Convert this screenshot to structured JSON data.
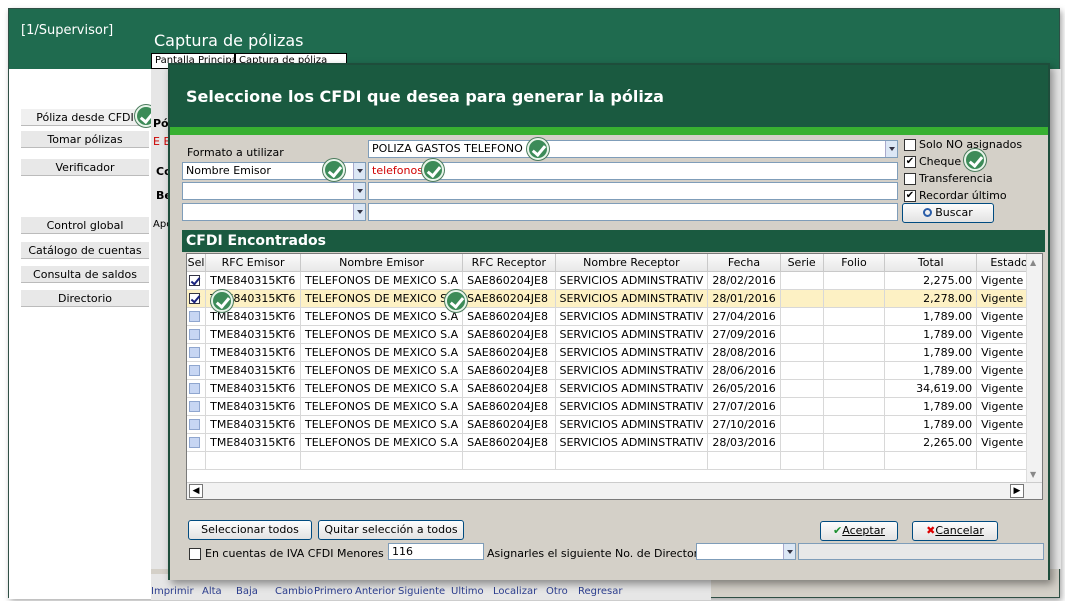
{
  "app": {
    "user": "[1/Supervisor]",
    "title": "Captura de pólizas",
    "tabs": [
      "Pantalla Principal",
      "Captura de póliza"
    ],
    "background_labels": {
      "pol": "Pól",
      "e": "E E",
      "co": "Co",
      "be": "Be",
      "ape": "Ape"
    }
  },
  "sidebar": {
    "items": [
      "Póliza desde CFDI",
      "Tomar pólizas",
      "Verificador",
      "Control global",
      "Catálogo de cuentas",
      "Consulta de saldos",
      "Directorio"
    ]
  },
  "toolbar": {
    "items": [
      "Imprimir",
      "Alta",
      "Baja",
      "Cambio",
      "Primero",
      "Anterior",
      "Siguiente",
      "Ultimo",
      "Localizar",
      "Otro",
      "Regresar"
    ]
  },
  "dialog": {
    "title": "Seleccione los CFDI que desea para generar la póliza",
    "format_label": "Formato a utilizar",
    "format_value": "POLIZA GASTOS TELEFONO",
    "filter1_field": "Nombre Emisor",
    "filter1_value": "telefonos",
    "filter2_field": "",
    "filter2_value": "",
    "filter3_field": "",
    "filter3_value": "",
    "options": [
      {
        "label": "Solo NO asignados",
        "checked": false
      },
      {
        "label": "Cheque",
        "checked": true
      },
      {
        "label": "Transferencia",
        "checked": false
      },
      {
        "label": "Recordar último",
        "checked": true
      }
    ],
    "search_button": "Buscar",
    "found_title": "CFDI Encontrados",
    "columns": [
      "Sel",
      "RFC Emisor",
      "Nombre Emisor",
      "RFC Receptor",
      "Nombre Receptor",
      "Fecha",
      "Serie",
      "Folio",
      "Total",
      "Estado"
    ],
    "rows": [
      {
        "sel": true,
        "rfc_emisor": "TME840315KT6",
        "nombre_emisor": "TELEFONOS DE MEXICO S.A",
        "rfc_receptor": "SAE860204JE8",
        "nombre_receptor": "SERVICIOS ADMINSTRATIV",
        "fecha": "28/02/2016",
        "serie": "",
        "folio": "",
        "total": "2,275.00",
        "estado": "Vigente"
      },
      {
        "sel": true,
        "rfc_emisor": "TME840315KT6",
        "nombre_emisor": "TELEFONOS DE MEXICO S.A",
        "rfc_receptor": "SAE860204JE8",
        "nombre_receptor": "SERVICIOS ADMINSTRATIV",
        "fecha": "28/01/2016",
        "serie": "",
        "folio": "",
        "total": "2,278.00",
        "estado": "Vigente",
        "highlight": true
      },
      {
        "sel": false,
        "rfc_emisor": "TME840315KT6",
        "nombre_emisor": "TELEFONOS DE MEXICO S.A",
        "rfc_receptor": "SAE860204JE8",
        "nombre_receptor": "SERVICIOS ADMINSTRATIV",
        "fecha": "27/04/2016",
        "serie": "",
        "folio": "",
        "total": "1,789.00",
        "estado": "Vigente"
      },
      {
        "sel": false,
        "rfc_emisor": "TME840315KT6",
        "nombre_emisor": "TELEFONOS DE MEXICO S.A",
        "rfc_receptor": "SAE860204JE8",
        "nombre_receptor": "SERVICIOS ADMINSTRATIV",
        "fecha": "27/09/2016",
        "serie": "",
        "folio": "",
        "total": "1,789.00",
        "estado": "Vigente"
      },
      {
        "sel": false,
        "rfc_emisor": "TME840315KT6",
        "nombre_emisor": "TELEFONOS DE MEXICO S.A",
        "rfc_receptor": "SAE860204JE8",
        "nombre_receptor": "SERVICIOS ADMINSTRATIV",
        "fecha": "28/08/2016",
        "serie": "",
        "folio": "",
        "total": "1,789.00",
        "estado": "Vigente"
      },
      {
        "sel": false,
        "rfc_emisor": "TME840315KT6",
        "nombre_emisor": "TELEFONOS DE MEXICO S.A",
        "rfc_receptor": "SAE860204JE8",
        "nombre_receptor": "SERVICIOS ADMINSTRATIV",
        "fecha": "28/06/2016",
        "serie": "",
        "folio": "",
        "total": "1,789.00",
        "estado": "Vigente"
      },
      {
        "sel": false,
        "rfc_emisor": "TME840315KT6",
        "nombre_emisor": "TELEFONOS DE MEXICO S.A",
        "rfc_receptor": "SAE860204JE8",
        "nombre_receptor": "SERVICIOS ADMINSTRATIV",
        "fecha": "26/05/2016",
        "serie": "",
        "folio": "",
        "total": "34,619.00",
        "estado": "Vigente"
      },
      {
        "sel": false,
        "rfc_emisor": "TME840315KT6",
        "nombre_emisor": "TELEFONOS DE MEXICO S.A",
        "rfc_receptor": "SAE860204JE8",
        "nombre_receptor": "SERVICIOS ADMINSTRATIV",
        "fecha": "27/07/2016",
        "serie": "",
        "folio": "",
        "total": "1,789.00",
        "estado": "Vigente"
      },
      {
        "sel": false,
        "rfc_emisor": "TME840315KT6",
        "nombre_emisor": "TELEFONOS DE MEXICO S.A",
        "rfc_receptor": "SAE860204JE8",
        "nombre_receptor": "SERVICIOS ADMINSTRATIV",
        "fecha": "27/10/2016",
        "serie": "",
        "folio": "",
        "total": "1,789.00",
        "estado": "Vigente"
      },
      {
        "sel": false,
        "rfc_emisor": "TME840315KT6",
        "nombre_emisor": "TELEFONOS DE MEXICO S.A",
        "rfc_receptor": "SAE860204JE8",
        "nombre_receptor": "SERVICIOS ADMINSTRATIV",
        "fecha": "28/03/2016",
        "serie": "",
        "folio": "",
        "total": "2,265.00",
        "estado": "Vigente"
      }
    ],
    "select_all_button": "Seleccionar todos",
    "clear_selection_button": "Quitar selección a todos",
    "accept_button": "Aceptar",
    "cancel_button": "Cancelar",
    "iva_label": "En cuentas de IVA CFDI Menores a:",
    "iva_checked": false,
    "iva_value": "116",
    "directory_label": "Asignarles el siguiente No. de Directorio",
    "directory_value": ""
  },
  "colors": {
    "header_green": "#1f6b4f",
    "dialog_green": "#1a5a40",
    "accent_green": "#38b031",
    "filter_value_red": "#d00000",
    "highlight_row": "#fdf1c4"
  }
}
